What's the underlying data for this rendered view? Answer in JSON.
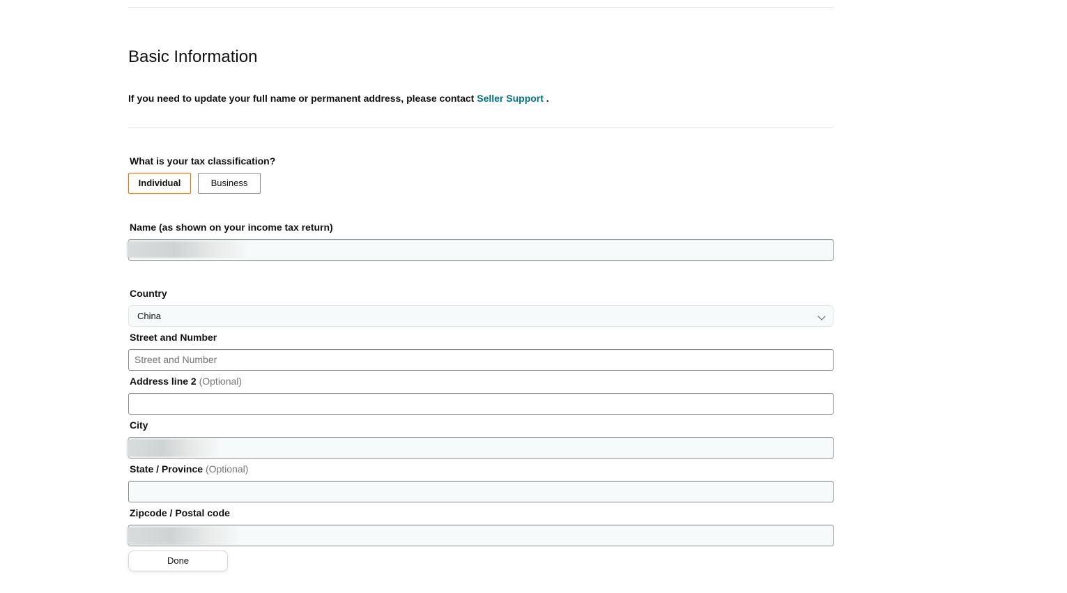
{
  "section": {
    "title": "Basic Information",
    "info_prefix": "If you need to update your full name or permanent address, please contact ",
    "info_link": "Seller Support",
    "info_suffix": " ."
  },
  "tax_classification": {
    "label": "What is your tax classification?",
    "options": [
      "Individual",
      "Business"
    ],
    "selected": "Individual"
  },
  "name_field": {
    "label": "Name (as shown on your income tax return)"
  },
  "country": {
    "label": "Country",
    "value": "China"
  },
  "street": {
    "label": "Street and Number",
    "placeholder": "Street and Number"
  },
  "address2": {
    "label": "Address line 2",
    "optional": "(Optional)"
  },
  "city": {
    "label": "City"
  },
  "state": {
    "label": "State / Province",
    "optional": "(Optional)"
  },
  "zipcode": {
    "label": "Zipcode / Postal code"
  },
  "done_label": "Done",
  "colors": {
    "link": "#007185",
    "selected_border": "#e77600"
  },
  "icons": {
    "country_dropdown": "chevron-down-icon"
  }
}
